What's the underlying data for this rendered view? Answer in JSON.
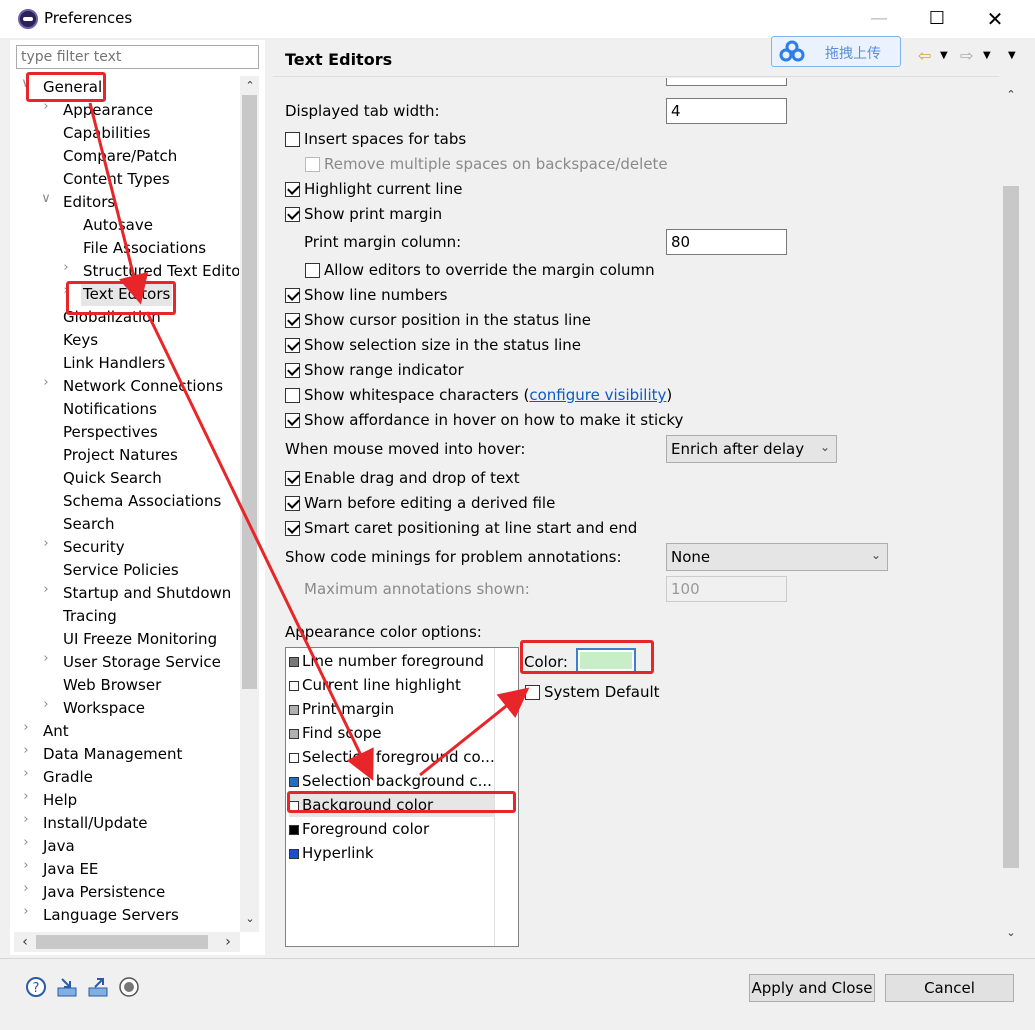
{
  "window": {
    "title": "Preferences"
  },
  "filter": {
    "placeholder": "type filter text"
  },
  "tree": [
    {
      "label": "General",
      "level": 0,
      "expanded": true
    },
    {
      "label": "Appearance",
      "level": 1,
      "arrow": true
    },
    {
      "label": "Capabilities",
      "level": 1
    },
    {
      "label": "Compare/Patch",
      "level": 1
    },
    {
      "label": "Content Types",
      "level": 1
    },
    {
      "label": "Editors",
      "level": 1,
      "expanded": true
    },
    {
      "label": "Autosave",
      "level": 2
    },
    {
      "label": "File Associations",
      "level": 2
    },
    {
      "label": "Structured Text Editors",
      "level": 2,
      "arrow": true
    },
    {
      "label": "Text Editors",
      "level": 2,
      "arrow": true,
      "selected": true
    },
    {
      "label": "Globalization",
      "level": 1
    },
    {
      "label": "Keys",
      "level": 1
    },
    {
      "label": "Link Handlers",
      "level": 1
    },
    {
      "label": "Network Connections",
      "level": 1,
      "arrow": true
    },
    {
      "label": "Notifications",
      "level": 1
    },
    {
      "label": "Perspectives",
      "level": 1
    },
    {
      "label": "Project Natures",
      "level": 1
    },
    {
      "label": "Quick Search",
      "level": 1
    },
    {
      "label": "Schema Associations",
      "level": 1
    },
    {
      "label": "Search",
      "level": 1
    },
    {
      "label": "Security",
      "level": 1,
      "arrow": true
    },
    {
      "label": "Service Policies",
      "level": 1
    },
    {
      "label": "Startup and Shutdown",
      "level": 1,
      "arrow": true
    },
    {
      "label": "Tracing",
      "level": 1
    },
    {
      "label": "UI Freeze Monitoring",
      "level": 1
    },
    {
      "label": "User Storage Service",
      "level": 1,
      "arrow": true
    },
    {
      "label": "Web Browser",
      "level": 1
    },
    {
      "label": "Workspace",
      "level": 1,
      "arrow": true
    },
    {
      "label": "Ant",
      "level": 0,
      "arrow": true
    },
    {
      "label": "Data Management",
      "level": 0,
      "arrow": true
    },
    {
      "label": "Gradle",
      "level": 0,
      "arrow": true
    },
    {
      "label": "Help",
      "level": 0,
      "arrow": true
    },
    {
      "label": "Install/Update",
      "level": 0,
      "arrow": true
    },
    {
      "label": "Java",
      "level": 0,
      "arrow": true
    },
    {
      "label": "Java EE",
      "level": 0,
      "arrow": true
    },
    {
      "label": "Java Persistence",
      "level": 0,
      "arrow": true
    },
    {
      "label": "Language Servers",
      "level": 0,
      "arrow": true
    }
  ],
  "page": {
    "title": "Text Editors",
    "upload_label": "拖拽上传",
    "tab_width_label": "Displayed tab width:",
    "tab_width_value": "4",
    "insert_spaces": "Insert spaces for tabs",
    "remove_multiple": "Remove multiple spaces on backspace/delete",
    "highlight_line": "Highlight current line",
    "show_print_margin": "Show print margin",
    "print_margin_col_label": "Print margin column:",
    "print_margin_col_value": "80",
    "allow_override": "Allow editors to override the margin column",
    "show_line_numbers": "Show line numbers",
    "show_cursor_pos": "Show cursor position in the status line",
    "show_sel_size": "Show selection size in the status line",
    "show_range": "Show range indicator",
    "show_whitespace": "Show whitespace characters (",
    "configure_visibility": "configure visibility",
    "close_paren": ")",
    "show_affordance": "Show affordance in hover on how to make it sticky",
    "hover_label": "When mouse moved into hover:",
    "hover_value": "Enrich after delay",
    "drag_drop": "Enable drag and drop of text",
    "warn_derived": "Warn before editing a derived file",
    "smart_caret": "Smart caret positioning at line start and end",
    "minings_label": "Show code minings for problem annotations:",
    "minings_value": "None",
    "max_annotations_label": "Maximum annotations shown:",
    "max_annotations_value": "100",
    "appearance_label": "Appearance color options:",
    "color_label": "Color:",
    "system_default": "System Default",
    "color_value": "#c7eec6"
  },
  "color_options": [
    {
      "label": "Line number foreground",
      "swatch": "#787878"
    },
    {
      "label": "Current line highlight",
      "swatch": "#ffffff"
    },
    {
      "label": "Print margin",
      "swatch": "#b0b0b0"
    },
    {
      "label": "Find scope",
      "swatch": "#b0b0b0"
    },
    {
      "label": "Selection foreground co...",
      "swatch": "#ffffff"
    },
    {
      "label": "Selection background c...",
      "swatch": "#1e6fc8"
    },
    {
      "label": "Background color",
      "swatch": "#ffffff",
      "selected": true
    },
    {
      "label": "Foreground color",
      "swatch": "#000000"
    },
    {
      "label": "Hyperlink",
      "swatch": "#1a4fd0"
    }
  ],
  "buttons": {
    "apply_close": "Apply and Close",
    "cancel": "Cancel"
  }
}
